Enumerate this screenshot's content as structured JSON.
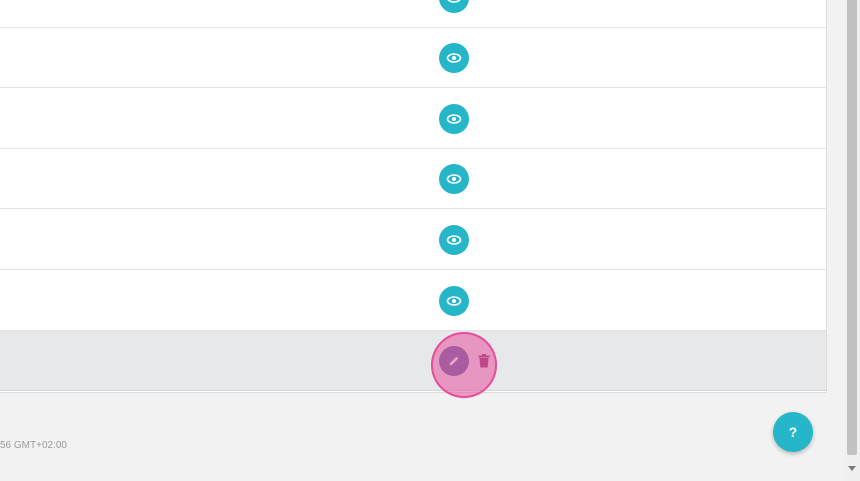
{
  "table": {
    "rows": [
      {
        "action": "view-icon"
      },
      {
        "action": "view-icon"
      },
      {
        "action": "view-icon"
      },
      {
        "action": "view-icon"
      },
      {
        "action": "view-icon"
      },
      {
        "action": "view-icon"
      },
      {
        "action": "edit-icon",
        "secondary_action": "trash-icon",
        "selected": true
      }
    ]
  },
  "footer": {
    "timestamp_fragment": "56 GMT+02:00"
  },
  "help": {
    "label": "?"
  },
  "colors": {
    "accent": "#26b6c9",
    "edit": "#5d6ba2",
    "delete": "#8a3e6e",
    "highlight": "#e64f9c"
  }
}
